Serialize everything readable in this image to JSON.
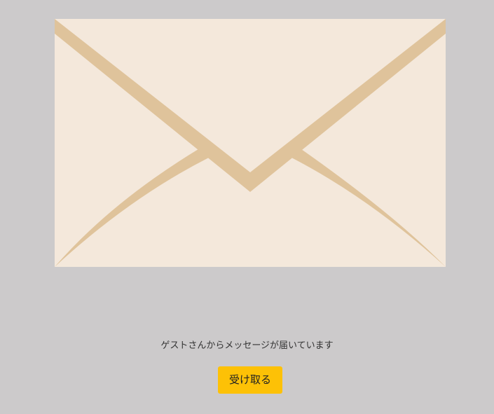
{
  "colors": {
    "background": "#cccacb",
    "envelope_paper": "#f4e8db",
    "envelope_fold": "#dfc39b",
    "button_background": "#fdc106",
    "text": "#333333"
  },
  "envelope": {
    "icon": "envelope-icon"
  },
  "message": {
    "text": "ゲストさんからメッセージが届いています"
  },
  "actions": {
    "receive_label": "受け取る"
  }
}
